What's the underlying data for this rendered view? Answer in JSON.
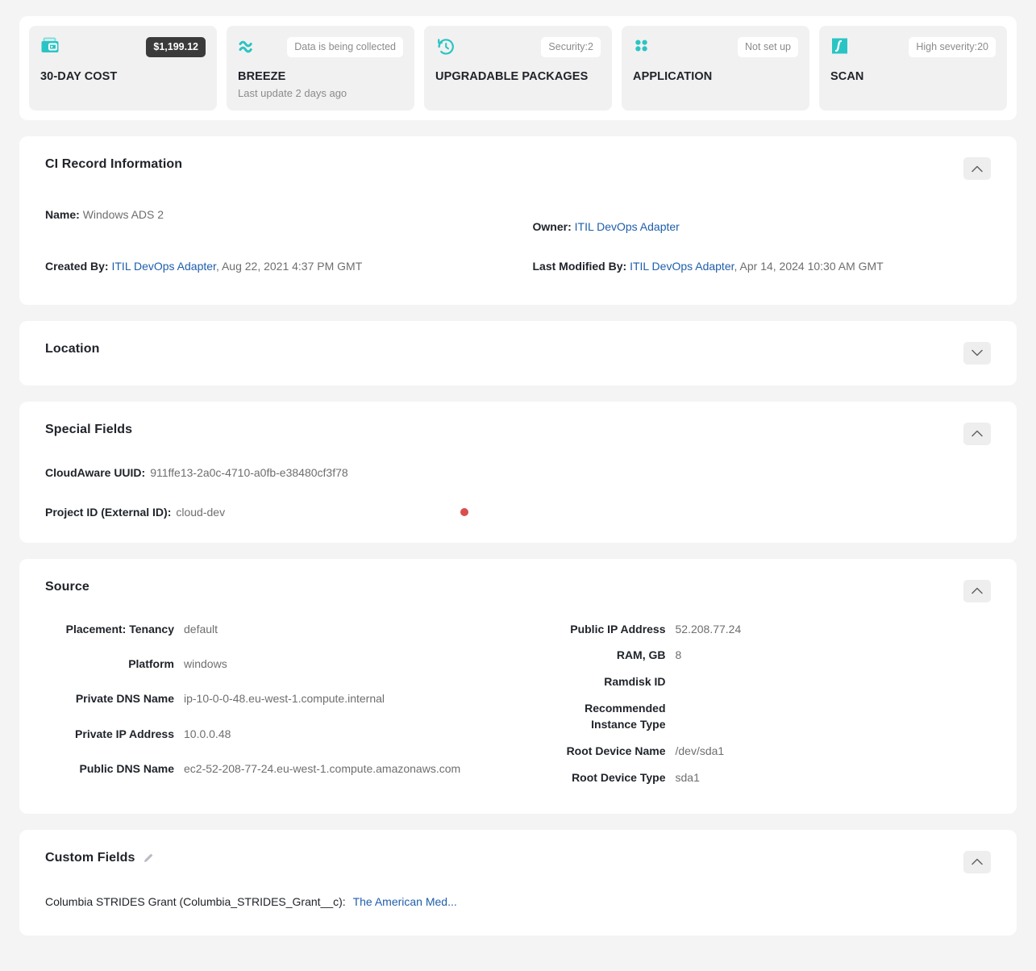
{
  "theme": {
    "page_bg": "#f4f4f4",
    "card_bg": "#ffffff",
    "tile_bg": "#f1f1f1",
    "accent_teal": "#2bc4c4",
    "link_blue": "#1f5eab",
    "badge_dark_bg": "#3b3b3b",
    "dot_red": "#d94f4f"
  },
  "tiles": [
    {
      "icon": "wallet-icon",
      "badge": "$1,199.12",
      "badge_style": "dark",
      "title": "30-DAY COST",
      "subtitle": ""
    },
    {
      "icon": "breeze-waves-icon",
      "badge": "Data is being collected",
      "badge_style": "light",
      "title": "BREEZE",
      "subtitle": "Last update 2 days ago"
    },
    {
      "icon": "history-clock-icon",
      "badge": "Security:2",
      "badge_style": "light",
      "title": "UPGRADABLE PACKAGES",
      "subtitle": ""
    },
    {
      "icon": "grid-dots-icon",
      "badge": "Not set up",
      "badge_style": "light",
      "title": "APPLICATION",
      "subtitle": ""
    },
    {
      "icon": "scan-curve-icon",
      "badge": "High severity:20",
      "badge_style": "light",
      "title": "SCAN",
      "subtitle": ""
    }
  ],
  "ci_record": {
    "title": "CI Record Information",
    "collapse_state": "expanded",
    "name_label": "Name:",
    "name_value": "Windows ADS 2",
    "owner_label": "Owner:",
    "owner_value": "ITIL DevOps Adapter",
    "created_by_label": "Created By:",
    "created_by_link": "ITIL DevOps Adapter",
    "created_by_date": ", Aug 22, 2021 4:37 PM GMT",
    "last_modified_label": "Last Modified By:",
    "last_modified_link": "ITIL DevOps Adapter",
    "last_modified_date": ", Apr 14, 2024 10:30 AM GMT"
  },
  "location": {
    "title": "Location",
    "collapse_state": "collapsed"
  },
  "special_fields": {
    "title": "Special Fields",
    "collapse_state": "expanded",
    "uuid_label": "CloudAware UUID:",
    "uuid_value": "911ffe13-2a0c-4710-a0fb-e38480cf3f78",
    "project_label": "Project ID (External ID):",
    "project_value": "cloud-dev"
  },
  "source": {
    "title": "Source",
    "collapse_state": "expanded",
    "left_fields": [
      {
        "label": "Placement: Tenancy",
        "value": "default"
      },
      {
        "label": "Platform",
        "value": "windows"
      },
      {
        "label": "Private DNS Name",
        "value": "ip-10-0-0-48.eu-west-1.compute.internal"
      },
      {
        "label": "Private IP Address",
        "value": "10.0.0.48"
      },
      {
        "label": "Public DNS Name",
        "value": "ec2-52-208-77-24.eu-west-1.compute.amazonaws.com"
      }
    ],
    "right_fields": [
      {
        "label": "Public IP Address",
        "value": "52.208.77.24"
      },
      {
        "label": "RAM, GB",
        "value": "8"
      },
      {
        "label": "Ramdisk ID",
        "value": ""
      },
      {
        "label": "Recommended Instance Type",
        "value": ""
      },
      {
        "label": "Root Device Name",
        "value": "/dev/sda1"
      },
      {
        "label": "Root Device Type",
        "value": "sda1"
      }
    ]
  },
  "custom_fields": {
    "title": "Custom Fields",
    "collapse_state": "expanded",
    "edit_icon": "pencil-icon",
    "field_label": "Columbia STRIDES Grant (Columbia_STRIDES_Grant__c):",
    "field_value": "The American Med..."
  }
}
